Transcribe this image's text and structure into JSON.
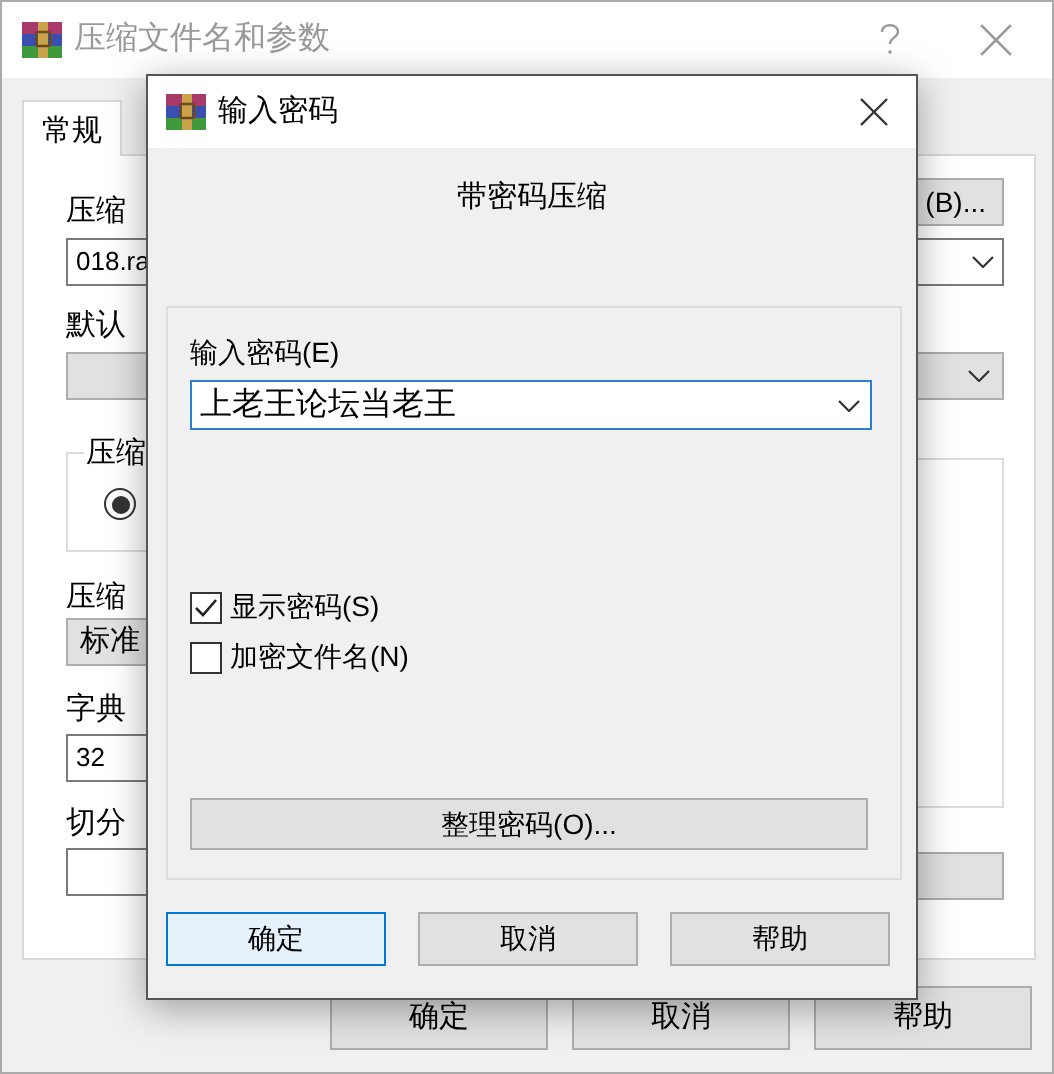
{
  "main_window": {
    "title": "压缩文件名和参数",
    "tabs": [
      {
        "label": "常规",
        "selected": true
      }
    ],
    "left_column": [
      {
        "kind": "label",
        "text": "压缩"
      },
      {
        "kind": "field",
        "value": "018.ra"
      },
      {
        "kind": "label",
        "text": "默认"
      },
      {
        "kind": "dropdown"
      },
      {
        "kind": "group",
        "legend": "压缩",
        "radio_selected": true
      },
      {
        "kind": "label",
        "text": "压缩"
      },
      {
        "kind": "dropdown",
        "value": "标准"
      },
      {
        "kind": "label",
        "text": "字典"
      },
      {
        "kind": "field",
        "value": "32"
      },
      {
        "kind": "label",
        "text": "切分"
      },
      {
        "kind": "field"
      }
    ],
    "right_column": [
      {
        "kind": "button",
        "text": "(B)..."
      },
      {
        "kind": "combo"
      },
      {
        "kind": "dropdown"
      },
      {
        "kind": "panel"
      },
      {
        "kind": "button"
      }
    ],
    "buttons": [
      "确定",
      "取消",
      "帮助"
    ]
  },
  "dialog": {
    "title": "输入密码",
    "heading": "带密码压缩",
    "password": {
      "label": "输入密码(E)",
      "value": "上老王论坛当老王"
    },
    "options": [
      {
        "label": "显示密码(S)",
        "checked": true
      },
      {
        "label": "加密文件名(N)",
        "checked": false
      }
    ],
    "organize_button": "整理密码(O)...",
    "buttons": [
      {
        "label": "确定",
        "default": true
      },
      {
        "label": "取消",
        "default": false
      },
      {
        "label": "帮助",
        "default": false
      }
    ]
  }
}
